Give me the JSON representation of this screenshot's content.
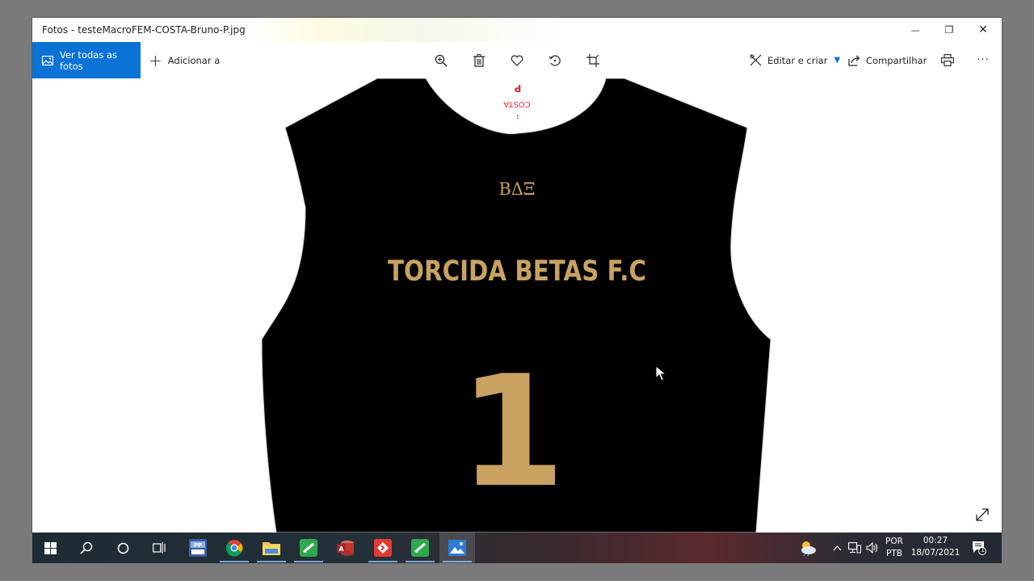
{
  "window": {
    "title": "Fotos - testeMacroFEM-COSTA-Bruno-P.jpg",
    "minimize_glyph": "—",
    "restore_glyph": "❐",
    "close_glyph": "✕"
  },
  "toolbar": {
    "view_all_label": "Ver todas as fotos",
    "add_to_label": "Adicionar a",
    "edit_create_label": "Editar e criar",
    "share_label": "Compartilhar",
    "more_glyph": "···",
    "icons": [
      "zoom-in-icon",
      "delete-icon",
      "favorite-heart-icon",
      "rotate-icon",
      "crop-icon",
      "print-icon"
    ]
  },
  "image": {
    "neck_label_size": "P",
    "neck_label_name": "COSTA",
    "neck_label_number": "1",
    "logo_text": "BΔΞ",
    "team_text": "TORCIDA BETAS F.C",
    "number_text": "1",
    "shirt_color": "#000000",
    "print_color": "#c9a261",
    "neck_label_color": "#e0312e"
  },
  "taskbar": {
    "apps": [
      "start-icon",
      "search-icon",
      "cortana-icon",
      "task-view-icon",
      "powerpoint-app-icon",
      "chrome-icon",
      "file-explorer-icon",
      "green-app-icon",
      "access-icon",
      "red-app-icon",
      "green-app-icon-2",
      "photos-app-icon"
    ],
    "language_top": "POR",
    "language_bottom": "PTB",
    "time": "00:27",
    "date": "18/07/2021",
    "notification_count": "1"
  }
}
